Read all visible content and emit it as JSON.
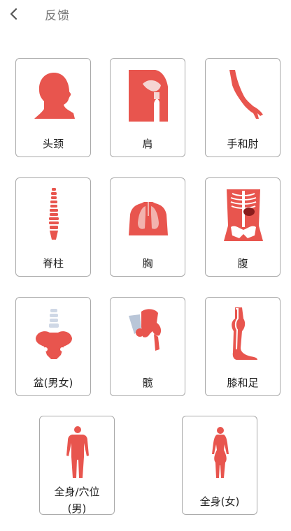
{
  "header": {
    "title": "反馈",
    "back_icon": "chevron-left-icon"
  },
  "accent_color": "#e8554e",
  "cards": [
    {
      "label": "头颈",
      "icon": "head-neck-icon"
    },
    {
      "label": "肩",
      "icon": "shoulder-icon"
    },
    {
      "label": "手和肘",
      "icon": "arm-hand-icon"
    },
    {
      "label": "脊柱",
      "icon": "spine-icon"
    },
    {
      "label": "胸",
      "icon": "chest-lungs-icon"
    },
    {
      "label": "腹",
      "icon": "abdomen-skeleton-icon"
    },
    {
      "label": "盆(男女)",
      "icon": "pelvis-icon"
    },
    {
      "label": "髋",
      "icon": "hip-joint-icon"
    },
    {
      "label": "膝和足",
      "icon": "leg-knee-icon"
    },
    {
      "label_line1": "全身/穴位",
      "label_line2": "(男)",
      "icon": "male-body-icon"
    },
    {
      "label": "全身(女)",
      "icon": "female-body-icon"
    }
  ]
}
